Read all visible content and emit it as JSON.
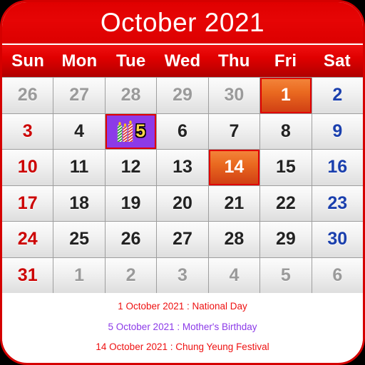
{
  "header": {
    "title": "October 2021",
    "background_color": "#e00000",
    "title_color": "#ffffff"
  },
  "weekdays": [
    {
      "label": "Sun",
      "type": "sunday"
    },
    {
      "label": "Mon",
      "type": "weekday"
    },
    {
      "label": "Tue",
      "type": "weekday"
    },
    {
      "label": "Wed",
      "type": "weekday"
    },
    {
      "label": "Thu",
      "type": "weekday"
    },
    {
      "label": "Fri",
      "type": "weekday"
    },
    {
      "label": "Sat",
      "type": "saturday"
    }
  ],
  "colors": {
    "accent_red": "#e00000",
    "sunday_text": "#cc0000",
    "saturday_text": "#1a3fad",
    "weekday_text": "#222222",
    "other_month_text": "#9a9a9a",
    "selected_bg": "#ea6a20",
    "event_bg": "#8c3ae8",
    "event_number": "#ffd64a"
  },
  "grid": {
    "rows": [
      [
        {
          "day": "26",
          "month": "prev",
          "state": "normal"
        },
        {
          "day": "27",
          "month": "prev",
          "state": "normal"
        },
        {
          "day": "28",
          "month": "prev",
          "state": "normal"
        },
        {
          "day": "29",
          "month": "prev",
          "state": "normal"
        },
        {
          "day": "30",
          "month": "prev",
          "state": "normal"
        },
        {
          "day": "1",
          "month": "current",
          "state": "selected"
        },
        {
          "day": "2",
          "month": "current",
          "state": "normal"
        }
      ],
      [
        {
          "day": "3",
          "month": "current",
          "state": "normal"
        },
        {
          "day": "4",
          "month": "current",
          "state": "normal"
        },
        {
          "day": "5",
          "month": "current",
          "state": "event",
          "icon": "birthday-candles-icon"
        },
        {
          "day": "6",
          "month": "current",
          "state": "normal"
        },
        {
          "day": "7",
          "month": "current",
          "state": "normal"
        },
        {
          "day": "8",
          "month": "current",
          "state": "normal"
        },
        {
          "day": "9",
          "month": "current",
          "state": "normal"
        }
      ],
      [
        {
          "day": "10",
          "month": "current",
          "state": "normal"
        },
        {
          "day": "11",
          "month": "current",
          "state": "normal"
        },
        {
          "day": "12",
          "month": "current",
          "state": "normal"
        },
        {
          "day": "13",
          "month": "current",
          "state": "normal"
        },
        {
          "day": "14",
          "month": "current",
          "state": "selected"
        },
        {
          "day": "15",
          "month": "current",
          "state": "normal"
        },
        {
          "day": "16",
          "month": "current",
          "state": "normal"
        }
      ],
      [
        {
          "day": "17",
          "month": "current",
          "state": "normal"
        },
        {
          "day": "18",
          "month": "current",
          "state": "normal"
        },
        {
          "day": "19",
          "month": "current",
          "state": "normal"
        },
        {
          "day": "20",
          "month": "current",
          "state": "normal"
        },
        {
          "day": "21",
          "month": "current",
          "state": "normal"
        },
        {
          "day": "22",
          "month": "current",
          "state": "normal"
        },
        {
          "day": "23",
          "month": "current",
          "state": "normal"
        }
      ],
      [
        {
          "day": "24",
          "month": "current",
          "state": "normal"
        },
        {
          "day": "25",
          "month": "current",
          "state": "normal"
        },
        {
          "day": "26",
          "month": "current",
          "state": "normal"
        },
        {
          "day": "27",
          "month": "current",
          "state": "normal"
        },
        {
          "day": "28",
          "month": "current",
          "state": "normal"
        },
        {
          "day": "29",
          "month": "current",
          "state": "normal"
        },
        {
          "day": "30",
          "month": "current",
          "state": "normal"
        }
      ],
      [
        {
          "day": "31",
          "month": "current",
          "state": "normal"
        },
        {
          "day": "1",
          "month": "next",
          "state": "normal"
        },
        {
          "day": "2",
          "month": "next",
          "state": "normal"
        },
        {
          "day": "3",
          "month": "next",
          "state": "normal"
        },
        {
          "day": "4",
          "month": "next",
          "state": "normal"
        },
        {
          "day": "5",
          "month": "next",
          "state": "normal"
        },
        {
          "day": "6",
          "month": "next",
          "state": "normal"
        }
      ]
    ]
  },
  "events": [
    {
      "text": "1 October 2021 : National Day",
      "color": "#ee1111"
    },
    {
      "text": "5 October 2021 : Mother's Birthday",
      "color": "#8c3ae8"
    },
    {
      "text": "14 October 2021 : Chung Yeung Festival",
      "color": "#ee1111"
    }
  ]
}
